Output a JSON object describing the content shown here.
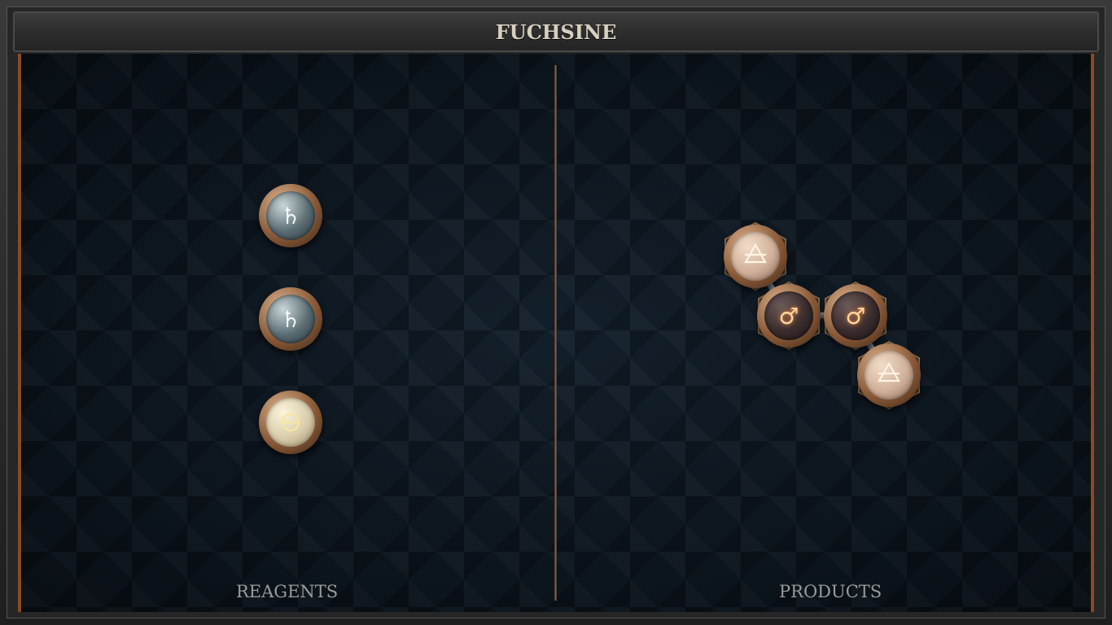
{
  "title": "FUCHSINE",
  "panels": {
    "reagents_label": "REAGENTS",
    "products_label": "PRODUCTS"
  },
  "reagents": [
    {
      "element": "lead",
      "symbol": "♄"
    },
    {
      "element": "lead",
      "symbol": "♄"
    },
    {
      "element": "salt",
      "symbol": "🜔"
    }
  ],
  "product": {
    "atoms": [
      {
        "element": "air",
        "symbol": "🜁"
      },
      {
        "element": "iron",
        "symbol": "♂"
      },
      {
        "element": "iron",
        "symbol": "♂"
      },
      {
        "element": "air",
        "symbol": "🜁"
      }
    ],
    "bonds": [
      [
        0,
        1
      ],
      [
        1,
        2
      ],
      [
        2,
        3
      ]
    ]
  },
  "colors": {
    "board": "#0f1a24",
    "frame_trim": "#8a4a22",
    "title_text": "#d8d0c0",
    "label_text": "#9a9a9a"
  }
}
